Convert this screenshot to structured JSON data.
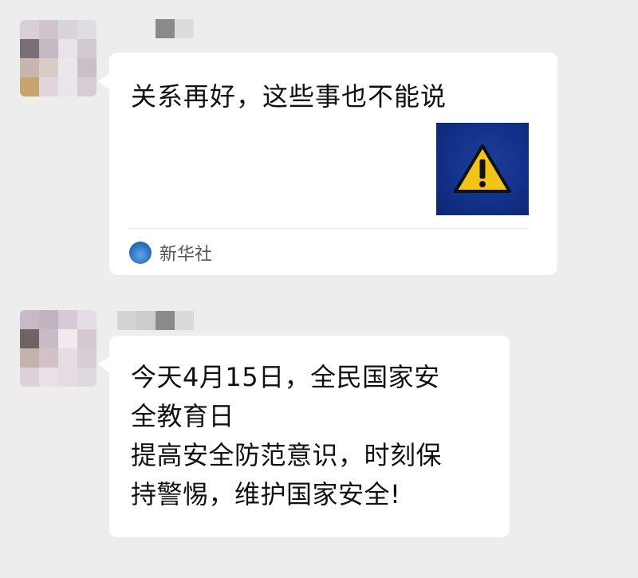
{
  "messages": [
    {
      "type": "link-card",
      "card": {
        "title": "关系再好，这些事也不能说",
        "thumbnail_icon": "warning-icon",
        "source_logo_text": "新华社",
        "source_name": "新华社"
      }
    },
    {
      "type": "text",
      "lines": [
        "今天4月15日，全民国家安",
        "全教育日",
        "提高安全防范意识，时刻保",
        "持警惕，维护国家安全!"
      ]
    }
  ],
  "colors": {
    "background": "#ededed",
    "bubble": "#ffffff",
    "thumbnail_bg": "#13318a",
    "warning_yellow": "#f2c418",
    "source_text": "#555555"
  }
}
